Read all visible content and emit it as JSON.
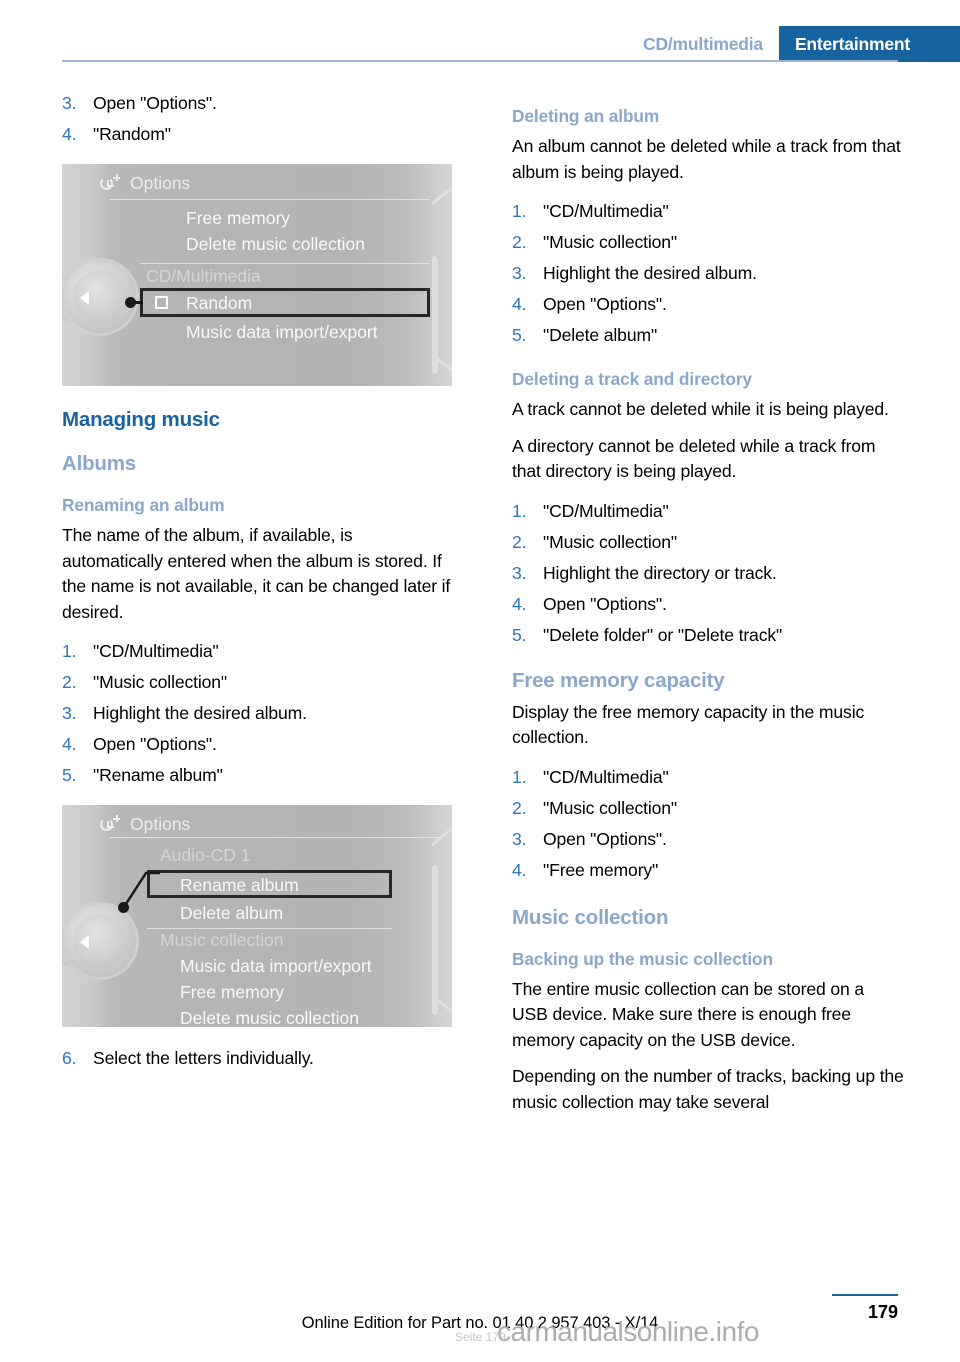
{
  "header": {
    "breadcrumb": "CD/multimedia",
    "section_tab": "Entertainment",
    "accent_color": "#17639f",
    "muted_color": "#8aa7c9"
  },
  "left_column": {
    "top_steps": [
      {
        "num": "3.",
        "text": "Open \"Options\"."
      },
      {
        "num": "4.",
        "text": "\"Random\""
      }
    ],
    "figure_random": {
      "title": "Options",
      "icon": "options-menu-icon",
      "items": [
        {
          "label": "Free memory",
          "style": "normal"
        },
        {
          "label": "Delete music collection",
          "style": "normal"
        },
        {
          "label": "CD/Multimedia",
          "style": "dim"
        },
        {
          "label": "Random",
          "style": "selected",
          "checkbox": true
        },
        {
          "label": "Music data import/export",
          "style": "normal"
        }
      ]
    },
    "heading_managing_music": "Managing music",
    "heading_albums": "Albums",
    "heading_renaming": "Renaming an album",
    "renaming_body": "The name of the album, if available, is automatically entered when the album is stored. If the name is not available, it can be changed later if desired.",
    "renaming_steps": [
      {
        "num": "1.",
        "text": "\"CD/Multimedia\""
      },
      {
        "num": "2.",
        "text": "\"Music collection\""
      },
      {
        "num": "3.",
        "text": "Highlight the desired album."
      },
      {
        "num": "4.",
        "text": "Open \"Options\"."
      },
      {
        "num": "5.",
        "text": "\"Rename album\""
      }
    ],
    "figure_rename": {
      "title": "Options",
      "icon": "options-menu-icon",
      "items": [
        {
          "label": "Audio-CD 1",
          "style": "dim"
        },
        {
          "label": "Rename album",
          "style": "selected"
        },
        {
          "label": "Delete album",
          "style": "normal"
        },
        {
          "label": "Music collection",
          "style": "dim"
        },
        {
          "label": "Music data import/export",
          "style": "normal"
        },
        {
          "label": "Free memory",
          "style": "normal"
        },
        {
          "label": "Delete music collection",
          "style": "normal"
        }
      ]
    },
    "final_step": {
      "num": "6.",
      "text": "Select the letters individually."
    }
  },
  "right_column": {
    "heading_deleting_album": "Deleting an album",
    "deleting_album_body": "An album cannot be deleted while a track from that album is being played.",
    "deleting_album_steps": [
      {
        "num": "1.",
        "text": "\"CD/Multimedia\""
      },
      {
        "num": "2.",
        "text": "\"Music collection\""
      },
      {
        "num": "3.",
        "text": "Highlight the desired album."
      },
      {
        "num": "4.",
        "text": "Open \"Options\"."
      },
      {
        "num": "5.",
        "text": "\"Delete album\""
      }
    ],
    "heading_deleting_track": "Deleting a track and directory",
    "deleting_track_body_1": "A track cannot be deleted while it is being played.",
    "deleting_track_body_2": "A directory cannot be deleted while a track from that directory is being played.",
    "deleting_track_steps": [
      {
        "num": "1.",
        "text": "\"CD/Multimedia\""
      },
      {
        "num": "2.",
        "text": "\"Music collection\""
      },
      {
        "num": "3.",
        "text": "Highlight the directory or track."
      },
      {
        "num": "4.",
        "text": "Open \"Options\"."
      },
      {
        "num": "5.",
        "text": "\"Delete folder\" or \"Delete track\""
      }
    ],
    "heading_free_memory": "Free memory capacity",
    "free_memory_body": "Display the free memory capacity in the music collection.",
    "free_memory_steps": [
      {
        "num": "1.",
        "text": "\"CD/Multimedia\""
      },
      {
        "num": "2.",
        "text": "\"Music collection\""
      },
      {
        "num": "3.",
        "text": "Open \"Options\"."
      },
      {
        "num": "4.",
        "text": "\"Free memory\""
      }
    ],
    "heading_music_collection": "Music collection",
    "heading_backing_up": "Backing up the music collection",
    "backing_up_body_1": "The entire music collection can be stored on a USB device. Make sure there is enough free memory capacity on the USB device.",
    "backing_up_body_2": "Depending on the number of tracks, backing up the music collection may take several"
  },
  "footer": {
    "page_number": "179",
    "note": "Online Edition for Part no. 01 40 2 957 403 - X/14",
    "watermark": "carmanualsonline.info",
    "watermark_sub": "Seite 179"
  }
}
